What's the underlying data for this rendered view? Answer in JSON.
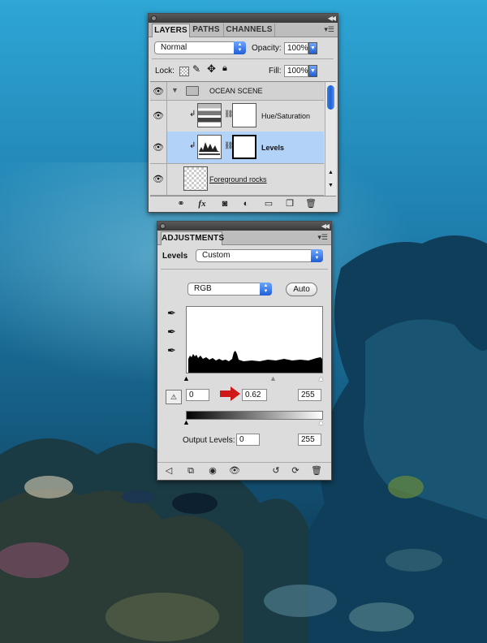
{
  "layers_panel": {
    "tabs": [
      "LAYERS",
      "PATHS",
      "CHANNELS"
    ],
    "blend_mode": "Normal",
    "opacity_label": "Opacity:",
    "opacity_value": "100%",
    "lock_label": "Lock:",
    "fill_label": "Fill:",
    "fill_value": "100%",
    "layers": [
      {
        "name": "OCEAN SCENE",
        "type": "group"
      },
      {
        "name": "Hue/Saturation",
        "type": "adjustment"
      },
      {
        "name": "Levels",
        "type": "adjustment",
        "selected": true
      },
      {
        "name": "Foreground rocks",
        "type": "pixel"
      }
    ],
    "footer_icons": [
      "link-icon",
      "fx-icon",
      "mask-icon",
      "adjustment-layer-icon",
      "group-folder-icon",
      "new-layer-icon",
      "trash-icon"
    ]
  },
  "adjustments_panel": {
    "tab": "ADJUSTMENTS",
    "preset_label": "Levels",
    "preset_value": "Custom",
    "channel_value": "RGB",
    "auto_label": "Auto",
    "input_black": "0",
    "input_gamma": "0.62",
    "input_white": "255",
    "output_label": "Output Levels:",
    "output_black": "0",
    "output_white": "255",
    "footer_icons": [
      "back-arrow-icon",
      "expand-view-icon",
      "clip-icon",
      "visibility-eye-icon",
      "previous-state-icon",
      "reset-icon",
      "trash-icon"
    ]
  },
  "colors": {
    "panel_bg": "#dcdcdc",
    "selected_row": "#b3d2f7",
    "accent_blue": "#1f5fd6",
    "annotation_arrow": "#d01818"
  }
}
